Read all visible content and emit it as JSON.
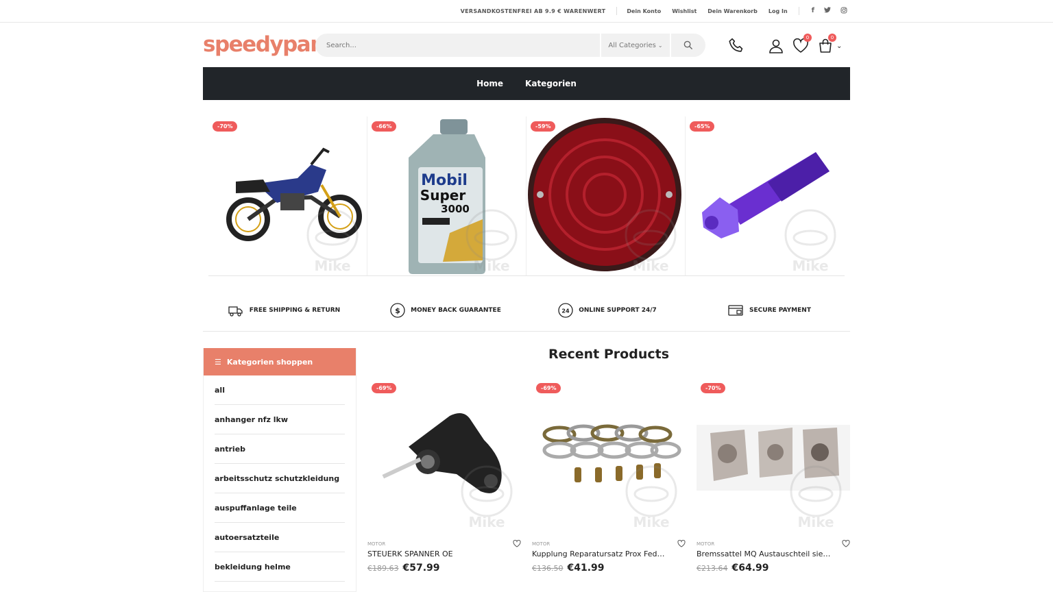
{
  "topbar": {
    "shipping": "VERSANDKOSTENFREI AB 9.9 € WARENWERT",
    "links": [
      "Dein Konto",
      "Wishlist",
      "Dein Warenkorb",
      "Log In"
    ],
    "social": [
      "facebook-icon",
      "twitter-icon",
      "instagram-icon"
    ]
  },
  "header": {
    "logo": "speedyparts",
    "search_placeholder": "Search...",
    "category_select": "All Categories",
    "wishlist_count": "0",
    "cart_count": "0"
  },
  "nav": {
    "items": [
      "Home",
      "Kategorien"
    ]
  },
  "slider": {
    "slides": [
      {
        "discount": "-70%",
        "alt": "motorcycle"
      },
      {
        "discount": "-66%",
        "alt": "oil"
      },
      {
        "discount": "-59%",
        "alt": "lamp"
      },
      {
        "discount": "-65%",
        "alt": "bolt"
      }
    ],
    "watermark": "Mike"
  },
  "features": [
    {
      "icon": "truck-icon",
      "label": "FREE SHIPPING & RETURN"
    },
    {
      "icon": "dollar-icon",
      "label": "MONEY BACK GUARANTEE"
    },
    {
      "icon": "support-24-icon",
      "label": "ONLINE SUPPORT 24/7"
    },
    {
      "icon": "card-icon",
      "label": "SECURE PAYMENT"
    }
  ],
  "sidebar": {
    "title": "Kategorien shoppen",
    "items": [
      "all",
      "anhanger nfz lkw",
      "antrieb",
      "arbeitsschutz schutzkleidung",
      "auspuffanlage teile",
      "autoersatzteile",
      "bekleidung helme"
    ]
  },
  "recent": {
    "title": "Recent Products",
    "products": [
      {
        "discount": "-69%",
        "category": "MOTOR",
        "name": "STEUERK SPANNER OE",
        "old_price": "€189.63",
        "price": "€57.99"
      },
      {
        "discount": "-69%",
        "category": "MOTOR",
        "name": "Kupplung Reparatursatz Prox Feder...",
        "old_price": "€136.50",
        "price": "€41.99"
      },
      {
        "discount": "-70%",
        "category": "MOTOR",
        "name": "Bremssattel MQ Austauschteil siehe...",
        "old_price": "€213.64",
        "price": "€64.99"
      }
    ]
  },
  "colors": {
    "accent": "#e8806a",
    "badge": "#ef5b5b",
    "nav_bg": "#212529"
  }
}
